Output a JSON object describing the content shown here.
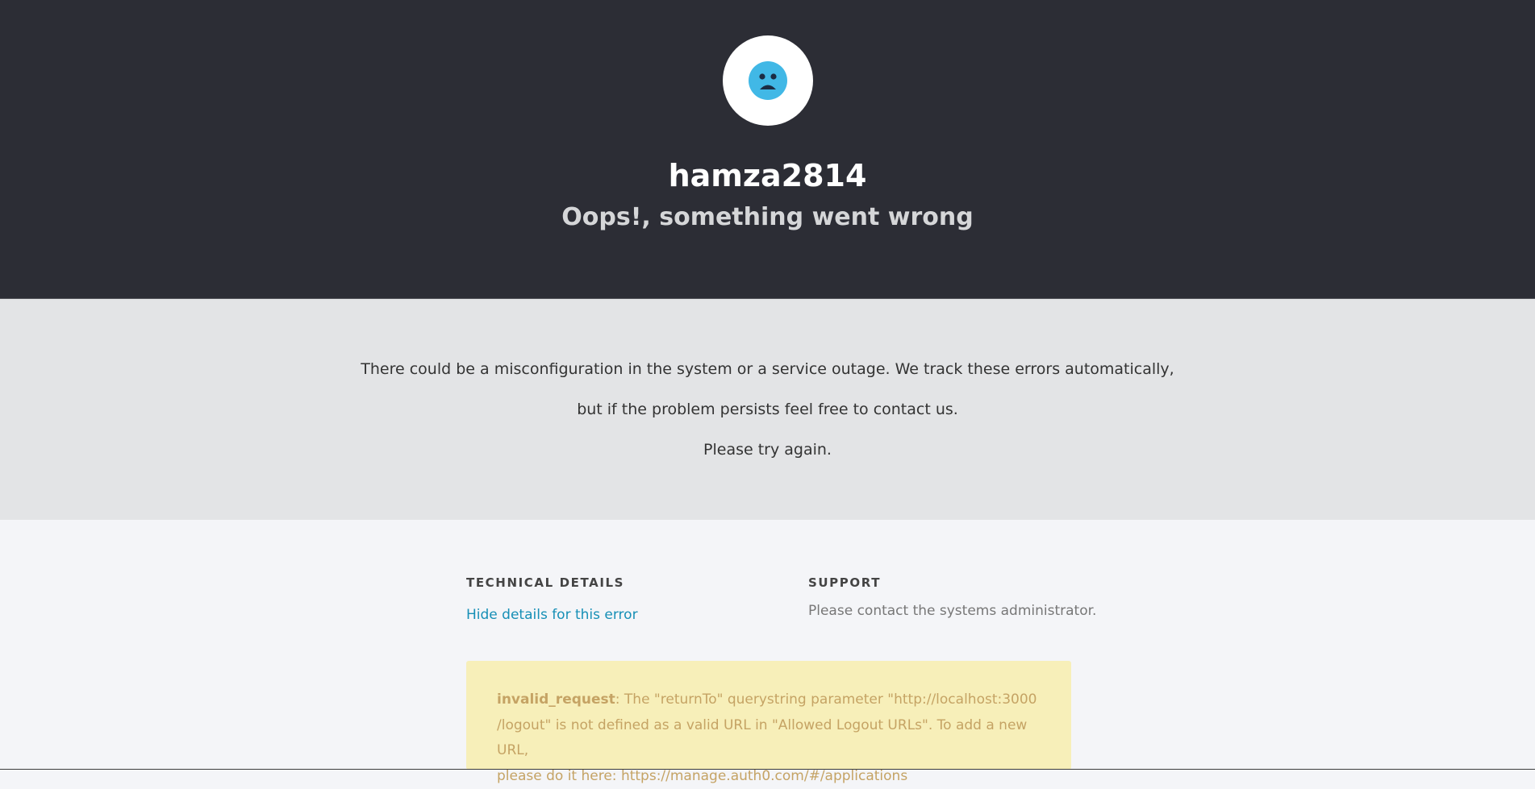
{
  "header": {
    "tenant_name": "hamza2814",
    "headline": "Oops!, something went wrong",
    "logo_icon": "sad-face-icon",
    "background_color": "#2c2d35",
    "icon_color": "#41b8e6"
  },
  "message": {
    "line1": "There could be a misconfiguration in the system or a service outage. We track these errors automatically,",
    "line2": "but if the problem persists feel free to contact us.",
    "line3": "Please try again."
  },
  "technical_details": {
    "title": "TECHNICAL DETAILS",
    "toggle_link": "Hide details for this error",
    "link_color": "#168fb6"
  },
  "support": {
    "title": "SUPPORT",
    "text": "Please contact the systems administrator."
  },
  "error": {
    "code": "invalid_request",
    "line1": ": The \"returnTo\" querystring parameter \"http://localhost:3000",
    "line2": "/logout\" is not defined as a valid URL in \"Allowed Logout URLs\". To add a new URL,",
    "line3": "please do it here: https://manage.auth0.com/#/applications",
    "background_color": "#f7efb9",
    "text_color": "#c5a364"
  }
}
